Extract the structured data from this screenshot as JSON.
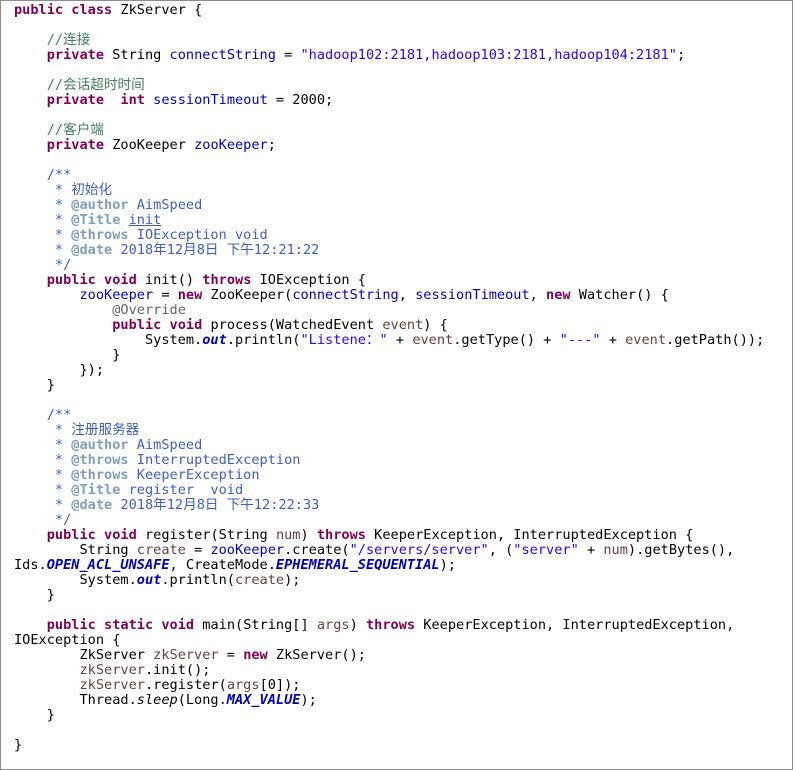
{
  "lines": [
    [
      {
        "t": "public class",
        "c": "kw"
      },
      {
        "t": " ZkServer {"
      }
    ],
    [],
    [
      {
        "t": "    "
      },
      {
        "t": "//连接",
        "c": "cm"
      }
    ],
    [
      {
        "t": "    "
      },
      {
        "t": "private",
        "c": "kw"
      },
      {
        "t": " String "
      },
      {
        "t": "connectString",
        "c": "fd"
      },
      {
        "t": " = "
      },
      {
        "t": "\"hadoop102:2181,hadoop103:2181,hadoop104:2181\"",
        "c": "st"
      },
      {
        "t": ";"
      }
    ],
    [],
    [
      {
        "t": "    "
      },
      {
        "t": "//会话超时时间",
        "c": "cm"
      }
    ],
    [
      {
        "t": "    "
      },
      {
        "t": "private",
        "c": "kw"
      },
      {
        "t": "  "
      },
      {
        "t": "int",
        "c": "kw"
      },
      {
        "t": " "
      },
      {
        "t": "sessionTimeout",
        "c": "fd"
      },
      {
        "t": " = 2000;"
      }
    ],
    [],
    [
      {
        "t": "    "
      },
      {
        "t": "//客户端",
        "c": "cm"
      }
    ],
    [
      {
        "t": "    "
      },
      {
        "t": "private",
        "c": "kw"
      },
      {
        "t": " ZooKeeper "
      },
      {
        "t": "zooKeeper",
        "c": "fd"
      },
      {
        "t": ";"
      }
    ],
    [],
    [
      {
        "t": "    "
      },
      {
        "t": "/**",
        "c": "jd"
      }
    ],
    [
      {
        "t": "     * 初始化",
        "c": "jd"
      }
    ],
    [
      {
        "t": "     * ",
        "c": "jd"
      },
      {
        "t": "@author",
        "c": "jt"
      },
      {
        "t": " AimSpeed",
        "c": "jd"
      }
    ],
    [
      {
        "t": "     * ",
        "c": "jd"
      },
      {
        "t": "@Title",
        "c": "jt"
      },
      {
        "t": " ",
        "c": "jd"
      },
      {
        "t": "init",
        "c": "jd",
        "u": true
      }
    ],
    [
      {
        "t": "     * ",
        "c": "jd"
      },
      {
        "t": "@throws",
        "c": "jt"
      },
      {
        "t": " IOException void",
        "c": "jd"
      }
    ],
    [
      {
        "t": "     * ",
        "c": "jd"
      },
      {
        "t": "@date",
        "c": "jt"
      },
      {
        "t": " 2018年12月8日 下午12:21:22",
        "c": "jd"
      }
    ],
    [
      {
        "t": "     */",
        "c": "jd"
      }
    ],
    [
      {
        "t": "    "
      },
      {
        "t": "public",
        "c": "kw"
      },
      {
        "t": " "
      },
      {
        "t": "void",
        "c": "kw"
      },
      {
        "t": " init() "
      },
      {
        "t": "throws",
        "c": "kw"
      },
      {
        "t": " IOException {"
      }
    ],
    [
      {
        "t": "        "
      },
      {
        "t": "zooKeeper",
        "c": "fd"
      },
      {
        "t": " = "
      },
      {
        "t": "new",
        "c": "kw"
      },
      {
        "t": " ZooKeeper("
      },
      {
        "t": "connectString",
        "c": "fd"
      },
      {
        "t": ", "
      },
      {
        "t": "sessionTimeout",
        "c": "fd"
      },
      {
        "t": ", "
      },
      {
        "t": "new",
        "c": "kw"
      },
      {
        "t": " Watcher() {"
      }
    ],
    [
      {
        "t": "            "
      },
      {
        "t": "@Override",
        "c": "an"
      }
    ],
    [
      {
        "t": "            "
      },
      {
        "t": "public",
        "c": "kw"
      },
      {
        "t": " "
      },
      {
        "t": "void",
        "c": "kw"
      },
      {
        "t": " process(WatchedEvent "
      },
      {
        "t": "event",
        "c": "lv"
      },
      {
        "t": ") {"
      }
    ],
    [
      {
        "t": "                System."
      },
      {
        "t": "out",
        "c": "sf"
      },
      {
        "t": ".println("
      },
      {
        "t": "\"Listene：\"",
        "c": "st"
      },
      {
        "t": " + "
      },
      {
        "t": "event",
        "c": "lv"
      },
      {
        "t": ".getType() + "
      },
      {
        "t": "\"---\"",
        "c": "st"
      },
      {
        "t": " + "
      },
      {
        "t": "event",
        "c": "lv"
      },
      {
        "t": ".getPath());"
      }
    ],
    [
      {
        "t": "            }"
      }
    ],
    [
      {
        "t": "        });"
      }
    ],
    [
      {
        "t": "    }"
      }
    ],
    [],
    [
      {
        "t": "    "
      },
      {
        "t": "/**",
        "c": "jd"
      }
    ],
    [
      {
        "t": "     * 注册服务器",
        "c": "jd"
      }
    ],
    [
      {
        "t": "     * ",
        "c": "jd"
      },
      {
        "t": "@author",
        "c": "jt"
      },
      {
        "t": " AimSpeed",
        "c": "jd"
      }
    ],
    [
      {
        "t": "     * ",
        "c": "jd"
      },
      {
        "t": "@throws",
        "c": "jt"
      },
      {
        "t": " InterruptedException",
        "c": "jd"
      }
    ],
    [
      {
        "t": "     * ",
        "c": "jd"
      },
      {
        "t": "@throws",
        "c": "jt"
      },
      {
        "t": " KeeperException",
        "c": "jd"
      }
    ],
    [
      {
        "t": "     * ",
        "c": "jd"
      },
      {
        "t": "@Title",
        "c": "jt"
      },
      {
        "t": " register  void",
        "c": "jd"
      }
    ],
    [
      {
        "t": "     * ",
        "c": "jd"
      },
      {
        "t": "@date",
        "c": "jt"
      },
      {
        "t": " 2018年12月8日 下午12:22:33",
        "c": "jd"
      }
    ],
    [
      {
        "t": "     */",
        "c": "jd"
      }
    ],
    [
      {
        "t": "    "
      },
      {
        "t": "public",
        "c": "kw"
      },
      {
        "t": " "
      },
      {
        "t": "void",
        "c": "kw"
      },
      {
        "t": " register(String "
      },
      {
        "t": "num",
        "c": "lv"
      },
      {
        "t": ") "
      },
      {
        "t": "throws",
        "c": "kw"
      },
      {
        "t": " KeeperException, InterruptedException {"
      }
    ],
    [
      {
        "t": "        String "
      },
      {
        "t": "create",
        "c": "lv"
      },
      {
        "t": " = "
      },
      {
        "t": "zooKeeper",
        "c": "fd"
      },
      {
        "t": ".create("
      },
      {
        "t": "\"/servers/server\"",
        "c": "st"
      },
      {
        "t": ", ("
      },
      {
        "t": "\"server\"",
        "c": "st"
      },
      {
        "t": " + "
      },
      {
        "t": "num",
        "c": "lv"
      },
      {
        "t": ").getBytes(),"
      }
    ],
    [
      {
        "t": "Ids."
      },
      {
        "t": "OPEN_ACL_UNSAFE",
        "c": "sf"
      },
      {
        "t": ", CreateMode."
      },
      {
        "t": "EPHEMERAL_SEQUENTIAL",
        "c": "sf"
      },
      {
        "t": ");"
      }
    ],
    [
      {
        "t": "        System."
      },
      {
        "t": "out",
        "c": "sf"
      },
      {
        "t": ".println("
      },
      {
        "t": "create",
        "c": "lv"
      },
      {
        "t": ");"
      }
    ],
    [
      {
        "t": "    }"
      }
    ],
    [],
    [
      {
        "t": "    "
      },
      {
        "t": "public",
        "c": "kw"
      },
      {
        "t": " "
      },
      {
        "t": "static",
        "c": "kw"
      },
      {
        "t": " "
      },
      {
        "t": "void",
        "c": "kw"
      },
      {
        "t": " main(String[] "
      },
      {
        "t": "args",
        "c": "lv"
      },
      {
        "t": ") "
      },
      {
        "t": "throws",
        "c": "kw"
      },
      {
        "t": " KeeperException, InterruptedException,"
      }
    ],
    [
      {
        "t": "IOException {"
      }
    ],
    [
      {
        "t": "        ZkServer "
      },
      {
        "t": "zkServer",
        "c": "lv"
      },
      {
        "t": " = "
      },
      {
        "t": "new",
        "c": "kw"
      },
      {
        "t": " ZkServer();"
      }
    ],
    [
      {
        "t": "        "
      },
      {
        "t": "zkServer",
        "c": "lv"
      },
      {
        "t": ".init();"
      }
    ],
    [
      {
        "t": "        "
      },
      {
        "t": "zkServer",
        "c": "lv"
      },
      {
        "t": ".register("
      },
      {
        "t": "args",
        "c": "lv"
      },
      {
        "t": "[0]);"
      }
    ],
    [
      {
        "t": "        Thread."
      },
      {
        "t": "sleep",
        "c": "it"
      },
      {
        "t": "(Long."
      },
      {
        "t": "MAX_VALUE",
        "c": "sf"
      },
      {
        "t": ");"
      }
    ],
    [
      {
        "t": "    }"
      }
    ],
    [],
    [
      {
        "t": "}"
      }
    ]
  ]
}
